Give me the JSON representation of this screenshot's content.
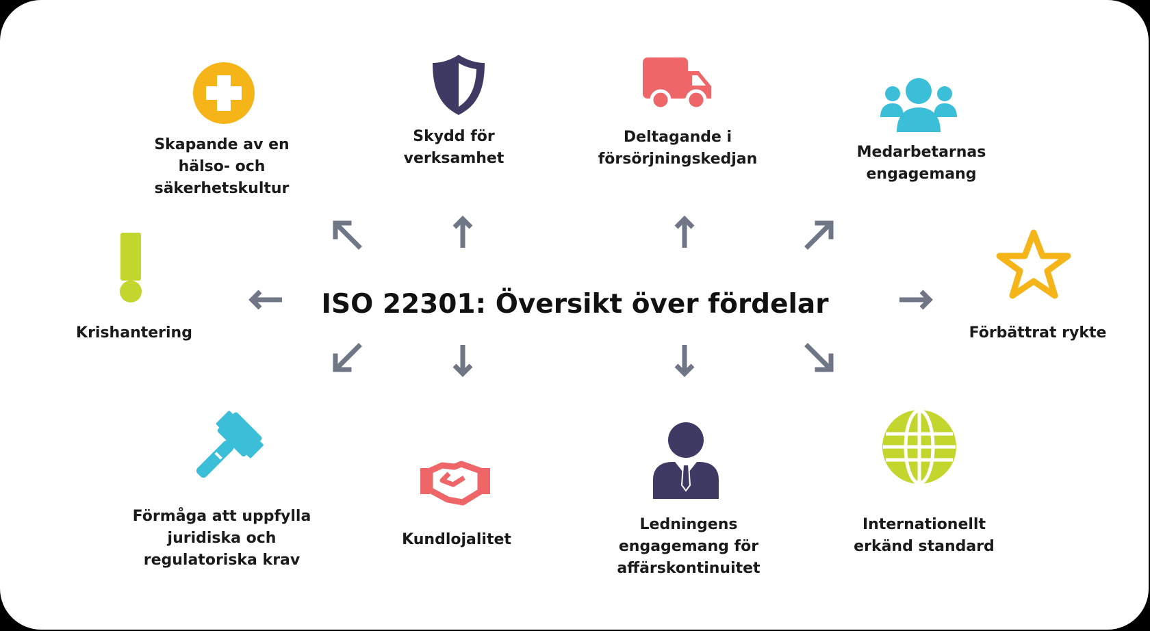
{
  "title": "ISO 22301: Översikt över fördelar",
  "colors": {
    "arrow": "#6f7685",
    "yellow": "#f5b418",
    "navy": "#3e3a63",
    "red": "#ef6669",
    "cyan": "#3bbfd9",
    "lime": "#c3d62d"
  },
  "benefits": [
    {
      "icon": "plus-circle-icon",
      "lines": [
        "Skapande av en",
        "hälso- och",
        "säkerhetskultur"
      ]
    },
    {
      "icon": "shield-icon",
      "lines": [
        "Skydd för",
        "verksamhet"
      ]
    },
    {
      "icon": "truck-icon",
      "lines": [
        "Deltagande i",
        "försörjningskedjan"
      ]
    },
    {
      "icon": "people-icon",
      "lines": [
        "Medarbetarnas",
        "engagemang"
      ]
    },
    {
      "icon": "exclamation-icon",
      "lines": [
        "Krishantering"
      ]
    },
    {
      "icon": "star-icon",
      "lines": [
        "Förbättrat rykte"
      ]
    },
    {
      "icon": "gavel-icon",
      "lines": [
        "Förmåga att uppfylla",
        "juridiska och",
        "regulatoriska krav"
      ]
    },
    {
      "icon": "handshake-icon",
      "lines": [
        "Kundlojalitet"
      ]
    },
    {
      "icon": "businessman-icon",
      "lines": [
        "Ledningens",
        "engagemang för",
        "affärskontinuitet"
      ]
    },
    {
      "icon": "globe-icon",
      "lines": [
        "Internationellt",
        "erkänd standard"
      ]
    }
  ]
}
